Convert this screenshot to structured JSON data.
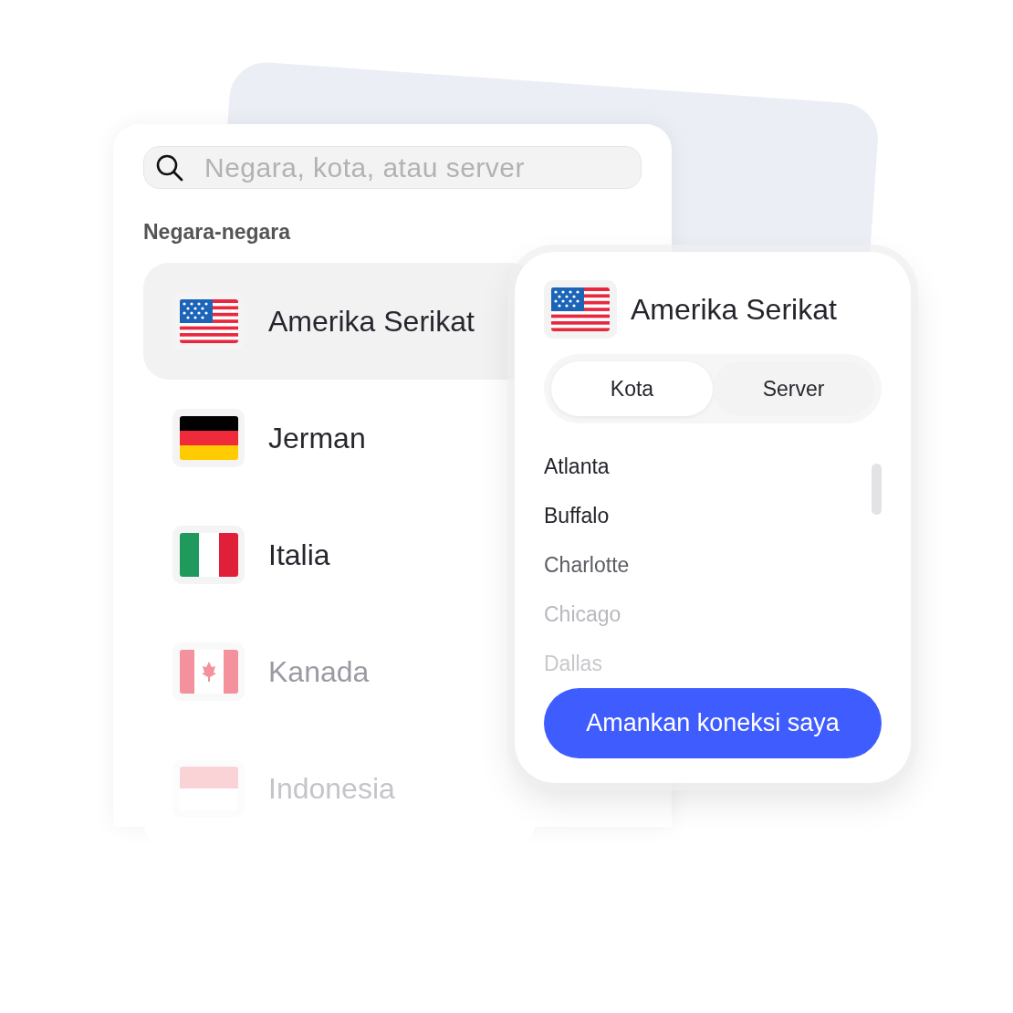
{
  "search": {
    "placeholder": "Negara, kota, atau server"
  },
  "section_label": "Negara-negara",
  "countries": [
    {
      "name": "Amerika Serikat",
      "kind": "us",
      "selected": true
    },
    {
      "name": "Jerman",
      "kind": "de",
      "selected": false
    },
    {
      "name": "Italia",
      "kind": "it",
      "selected": false
    },
    {
      "name": "Kanada",
      "kind": "ca",
      "selected": false
    },
    {
      "name": "Indonesia",
      "kind": "id",
      "selected": false
    }
  ],
  "detail": {
    "title": "Amerika Serikat",
    "kind": "us",
    "tabs": [
      {
        "label": "Kota",
        "selected": true
      },
      {
        "label": "Server",
        "selected": false
      }
    ],
    "cities": [
      {
        "name": "Atlanta"
      },
      {
        "name": "Buffalo"
      },
      {
        "name": "Charlotte"
      },
      {
        "name": "Chicago"
      },
      {
        "name": "Dallas"
      }
    ],
    "button": "Amankan koneksi saya"
  }
}
